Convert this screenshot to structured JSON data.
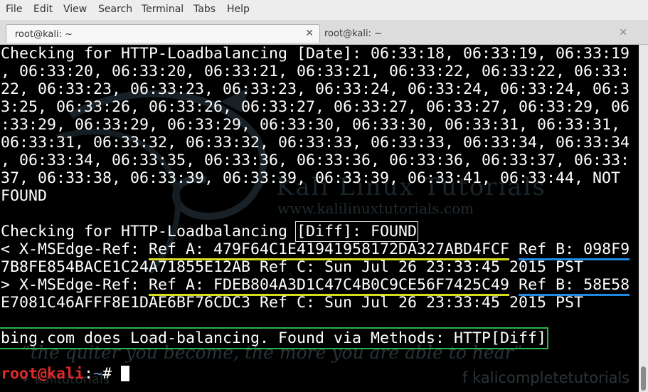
{
  "menubar": {
    "items": [
      "File",
      "Edit",
      "View",
      "Search",
      "Terminal",
      "Tabs",
      "Help"
    ]
  },
  "tabs": [
    {
      "label": "root@kali: ~",
      "close": "✕",
      "active": true
    },
    {
      "label": "root@kali: ~",
      "close": "✕",
      "active": false
    }
  ],
  "terminal": {
    "lines": [
      "Checking for HTTP-Loadbalancing [Date]: 06:33:18, 06:33:19, 06:33:19",
      ", 06:33:20, 06:33:20, 06:33:21, 06:33:21, 06:33:22, 06:33:22, 06:33:",
      "22, 06:33:23, 06:33:23, 06:33:23, 06:33:24, 06:33:24, 06:33:24, 06:3",
      "3:25, 06:33:26, 06:33:26, 06:33:27, 06:33:27, 06:33:27, 06:33:29, 06",
      ":33:29, 06:33:29, 06:33:29, 06:33:30, 06:33:30, 06:33:31, 06:33:31,",
      "06:33:31, 06:33:32, 06:33:32, 06:33:33, 06:33:33, 06:33:34, 06:33:34",
      ", 06:33:34, 06:33:35, 06:33:36, 06:33:36, 06:33:36, 06:33:37, 06:33:",
      "37, 06:33:38, 06:33:39, 06:33:39, 06:33:39, 06:33:41, 06:33:44, NOT",
      "FOUND",
      ""
    ],
    "diff_check": {
      "prefix": "Checking for HTTP-Loadbalancing ",
      "highlight": "[Diff]: FOUND"
    },
    "ref1": {
      "prefix": "< X-MSEdge-Ref: ",
      "ref_a": "Ref A: 479F64C1E41941958172DA327ABD4FCF",
      "ref_b": "Ref B: 098F9",
      "cont": "7B8FE854BACE1C24A71855E12AB Ref C: Sun Jul 26 23:33:45 2015 PST"
    },
    "ref2": {
      "prefix": "> X-MSEdge-Ref: ",
      "ref_a": "Ref A: FDEB804A3D1C47C4B0C9CE56F7425C49",
      "ref_b": "Ref B: 58E58",
      "cont": "E7081C46AFFF8E1DAE6BF76CDC3 Ref C: Sun Jul 26 23:33:45 2015 PST"
    },
    "result": "bing.com does Load-balancing. Found via Methods: HTTP[Diff]",
    "prompt": {
      "user": "root@kali",
      "sep": ":",
      "dir": "~",
      "symbol": "# "
    }
  },
  "watermarks": {
    "title": "Kali Linux Tutorials",
    "url": "www.kalilinuxtutorials.com",
    "quote": "“the quiter you become, the more you are able to hear”",
    "facebook": "kalicompletetutorials",
    "twitter": "kalitutorials"
  },
  "colors": {
    "terminal_bg": "#000000",
    "prompt_user": "#e02a2a",
    "prompt_dir": "#5f8bd6",
    "highlight_yellow": "#d6dc1e",
    "highlight_blue": "#1e88e5",
    "highlight_green": "#2bb54a"
  }
}
